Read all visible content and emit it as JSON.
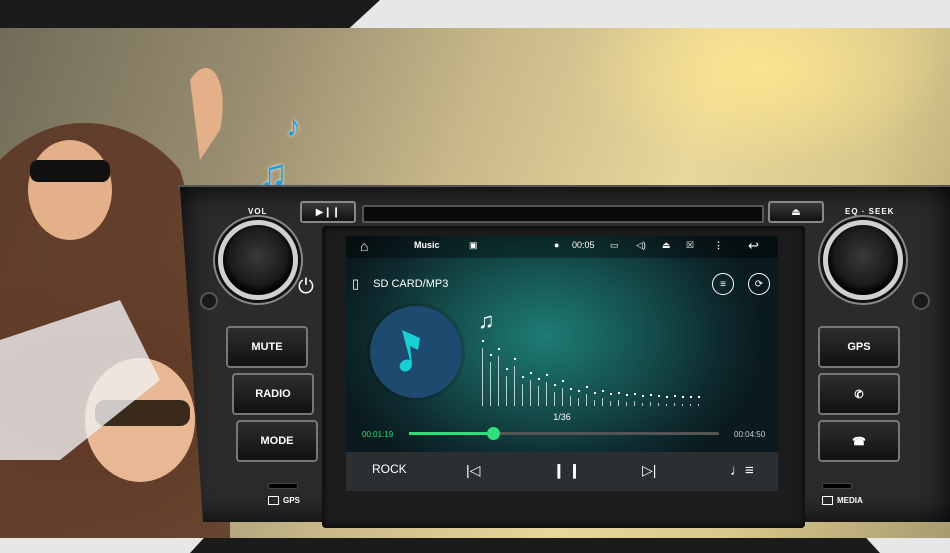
{
  "unit": {
    "knob_left_label": "VOL",
    "knob_right_label": "EQ · SEEK",
    "buttons_left": [
      "MUTE",
      "RADIO",
      "MODE"
    ],
    "buttons_right": [
      "GPS"
    ],
    "port_left_label": "GPS",
    "port_right_label": "MEDIA"
  },
  "screen": {
    "status": {
      "app_title": "Music",
      "clock": "00:05"
    },
    "source_label": "SD CARD/MP3",
    "track_counter": "1/36",
    "elapsed": "00:01:19",
    "duration": "00:04:50",
    "progress_fraction": 0.27,
    "eq_preset": "ROCK"
  },
  "colors": {
    "accent": "#2fe07a",
    "album_bg": "#1d4a6e",
    "note_blue": "#1aa0e8"
  }
}
